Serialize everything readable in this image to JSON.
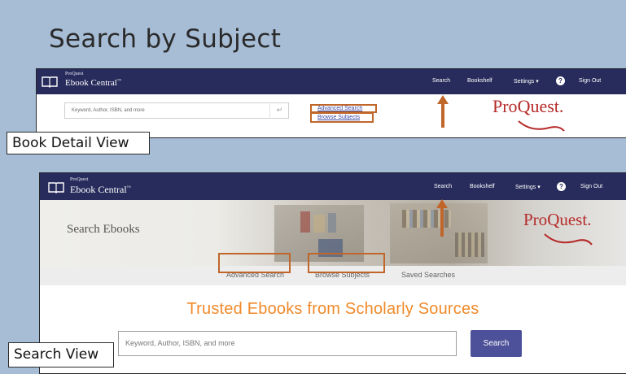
{
  "slide": {
    "title": "Search by Subject"
  },
  "colors": {
    "nav_bg": "#282c5c",
    "highlight": "#c0662a",
    "accent_orange": "#f08a2a",
    "button_bg": "#4d5199",
    "proquest_red": "#b52a29"
  },
  "book_detail_view": {
    "label": "Book Detail View",
    "brand": {
      "small": "ProQuest",
      "name": "Ebook Central",
      "tm": "™",
      "icon": "book-icon"
    },
    "nav": {
      "search": "Search",
      "bookshelf": "Bookshelf",
      "settings": "Settings ▾",
      "help": "?",
      "sign_out": "Sign Out"
    },
    "search": {
      "placeholder": "Keyword, Author, ISBN, and more",
      "enter_icon": "↵"
    },
    "links": {
      "advanced_search": "Advanced Search",
      "browse_subjects": "Browse Subjects"
    },
    "logo": {
      "pro": "Pro",
      "quest": "Quest",
      "dot": "."
    }
  },
  "search_view": {
    "label": "Search View",
    "brand": {
      "small": "ProQuest",
      "name": "Ebook Central",
      "tm": "™",
      "icon": "book-icon"
    },
    "nav": {
      "search": "Search",
      "bookshelf": "Bookshelf",
      "settings": "Settings ▾",
      "help": "?",
      "sign_out": "Sign Out"
    },
    "hero_title": "Search Ebooks",
    "logo": {
      "pro": "Pro",
      "quest": "Quest",
      "dot": "."
    },
    "subnav": {
      "advanced_search": "Advanced Search",
      "browse_subjects": "Browse Subjects",
      "saved_searches": "Saved Searches"
    },
    "tagline": "Trusted Ebooks from Scholarly Sources",
    "search": {
      "placeholder": "Keyword, Author, ISBN, and more",
      "button": "Search"
    }
  }
}
